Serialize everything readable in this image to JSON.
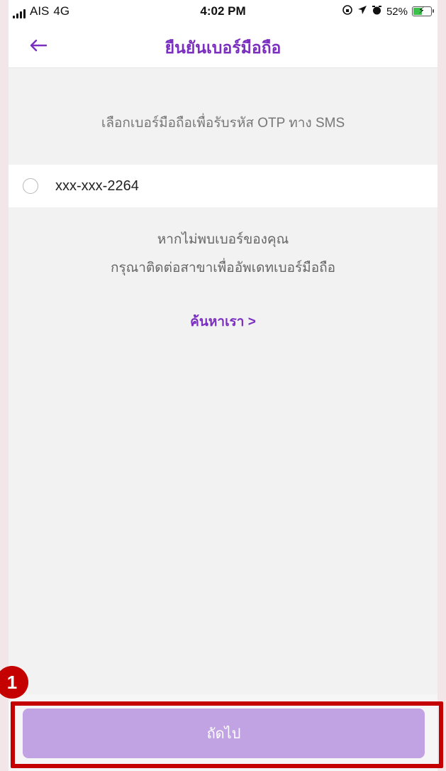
{
  "status_bar": {
    "carrier": "AIS",
    "network": "4G",
    "time": "4:02 PM",
    "icons": [
      "lock-rotation-icon",
      "location-icon",
      "alarm-icon"
    ],
    "battery_percent": "52%",
    "battery_level": 0.52,
    "charging": true
  },
  "header": {
    "title": "ยืนยันเบอร์มือถือ",
    "back_icon": "arrow-left-icon",
    "accent_color": "#7b2fbf"
  },
  "instruction": "เลือกเบอร์มือถือเพื่อรับรหัส OTP ทาง SMS",
  "phone_options": [
    {
      "number": "xxx-xxx-2264",
      "selected": false
    }
  ],
  "not_found": {
    "line1": "หากไม่พบเบอร์ของคุณ",
    "line2": "กรุณาติดต่อสาขาเพื่ออัพเดทเบอร์มือถือ"
  },
  "find_us_link": "ค้นหาเรา >",
  "next_button": {
    "label": "ถัดไป",
    "color": "#c1a2e3",
    "enabled": false
  },
  "annotation": {
    "step_number": "1",
    "color": "#c40000"
  }
}
